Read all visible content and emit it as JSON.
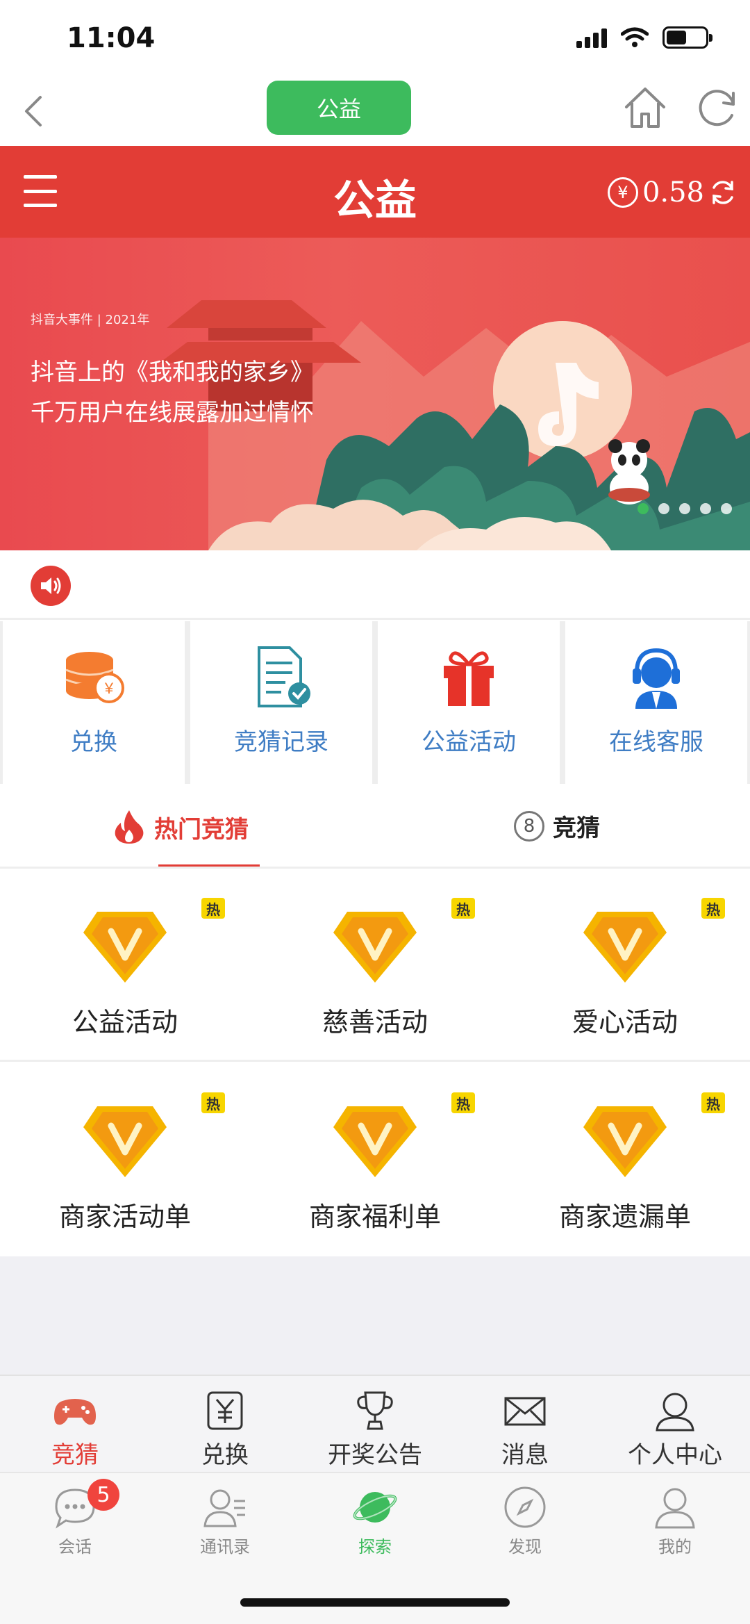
{
  "status_bar": {
    "time": "11:04"
  },
  "top_nav": {
    "pill_label": "公益"
  },
  "header": {
    "title": "公益",
    "currency_symbol": "¥",
    "balance": "0.58"
  },
  "banner": {
    "small_text": "抖音大事件 | 2021年",
    "line1": "抖音上的《我和我的家乡》",
    "line2": "千万用户在线展露加过情怀",
    "active_dot_color": "#3dbb5d"
  },
  "quick_actions": [
    {
      "label": "兑换",
      "icon": "coin-stack-icon"
    },
    {
      "label": "竞猜记录",
      "icon": "document-check-icon"
    },
    {
      "label": "公益活动",
      "icon": "gift-icon"
    },
    {
      "label": "在线客服",
      "icon": "customer-service-icon"
    }
  ],
  "tabs": [
    {
      "label": "热门竞猜",
      "icon": "flame-icon",
      "active": true
    },
    {
      "label": "竞猜",
      "icon": "circle-8-icon",
      "icon_text": "8",
      "active": false
    }
  ],
  "activities": [
    {
      "label": "公益活动",
      "tag": "热"
    },
    {
      "label": "慈善活动",
      "tag": "热"
    },
    {
      "label": "爱心活动",
      "tag": "热"
    },
    {
      "label": "商家活动单",
      "tag": "热"
    },
    {
      "label": "商家福利单",
      "tag": "热"
    },
    {
      "label": "商家遗漏单",
      "tag": "热"
    }
  ],
  "app_nav": [
    {
      "label": "竞猜",
      "icon": "gamepad-icon",
      "active": true
    },
    {
      "label": "兑换",
      "icon": "yen-box-icon",
      "active": false
    },
    {
      "label": "开奖公告",
      "icon": "trophy-icon",
      "active": false
    },
    {
      "label": "消息",
      "icon": "envelope-icon",
      "active": false
    },
    {
      "label": "个人中心",
      "icon": "user-icon",
      "active": false
    }
  ],
  "wechat_tabs": [
    {
      "label": "会话",
      "icon": "chat-icon",
      "badge": "5",
      "active": false
    },
    {
      "label": "通讯录",
      "icon": "contacts-icon",
      "active": false
    },
    {
      "label": "探索",
      "icon": "planet-icon",
      "active": true
    },
    {
      "label": "发现",
      "icon": "compass-icon",
      "active": false
    },
    {
      "label": "我的",
      "icon": "profile-icon",
      "active": false
    }
  ],
  "colors": {
    "brand_red": "#e23d36",
    "brand_green": "#3dbb5d",
    "link_blue": "#3f7dc4",
    "hot_tag_yellow": "#f7d500"
  }
}
